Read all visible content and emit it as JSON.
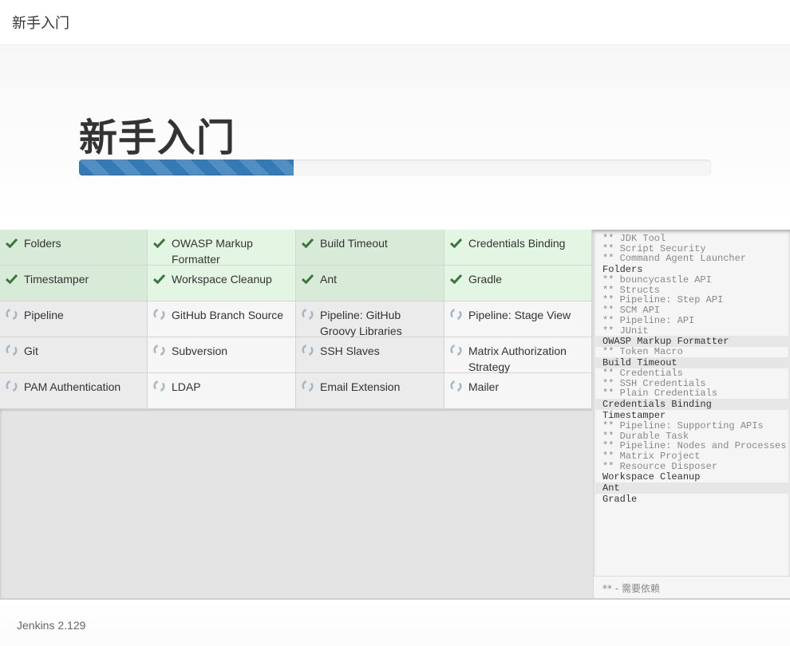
{
  "header": {
    "title": "新手入门"
  },
  "hero": {
    "title": "新手入门",
    "progress_percent": 34
  },
  "colors": {
    "progress_bar": "#337ab7",
    "success_check": "#3c763d",
    "pending_icon": "#a5b6c4"
  },
  "plugins": [
    {
      "name": "Folders",
      "status": "success"
    },
    {
      "name": "OWASP Markup Formatter",
      "status": "success"
    },
    {
      "name": "Build Timeout",
      "status": "success"
    },
    {
      "name": "Credentials Binding",
      "status": "success"
    },
    {
      "name": "Timestamper",
      "status": "success"
    },
    {
      "name": "Workspace Cleanup",
      "status": "success"
    },
    {
      "name": "Ant",
      "status": "success"
    },
    {
      "name": "Gradle",
      "status": "success"
    },
    {
      "name": "Pipeline",
      "status": "pending"
    },
    {
      "name": "GitHub Branch Source",
      "status": "pending"
    },
    {
      "name": "Pipeline: GitHub Groovy Libraries",
      "status": "pending"
    },
    {
      "name": "Pipeline: Stage View",
      "status": "pending"
    },
    {
      "name": "Git",
      "status": "pending"
    },
    {
      "name": "Subversion",
      "status": "pending"
    },
    {
      "name": "SSH Slaves",
      "status": "pending"
    },
    {
      "name": "Matrix Authorization Strategy",
      "status": "pending"
    },
    {
      "name": "PAM Authentication",
      "status": "pending"
    },
    {
      "name": "LDAP",
      "status": "pending"
    },
    {
      "name": "Email Extension",
      "status": "pending"
    },
    {
      "name": "Mailer",
      "status": "pending"
    }
  ],
  "log": [
    {
      "text": "** JDK Tool",
      "dep": true
    },
    {
      "text": "** Script Security",
      "dep": true
    },
    {
      "text": "** Command Agent Launcher",
      "dep": true
    },
    {
      "text": "Folders",
      "dep": false,
      "hl": false
    },
    {
      "text": "** bouncycastle API",
      "dep": true
    },
    {
      "text": "** Structs",
      "dep": true
    },
    {
      "text": "** Pipeline: Step API",
      "dep": true
    },
    {
      "text": "** SCM API",
      "dep": true
    },
    {
      "text": "** Pipeline: API",
      "dep": true
    },
    {
      "text": "** JUnit",
      "dep": true
    },
    {
      "text": "OWASP Markup Formatter",
      "dep": false,
      "hl": true
    },
    {
      "text": "** Token Macro",
      "dep": true
    },
    {
      "text": "Build Timeout",
      "dep": false,
      "hl": true
    },
    {
      "text": "** Credentials",
      "dep": true
    },
    {
      "text": "** SSH Credentials",
      "dep": true
    },
    {
      "text": "** Plain Credentials",
      "dep": true
    },
    {
      "text": "Credentials Binding",
      "dep": false,
      "hl": true
    },
    {
      "text": "Timestamper",
      "dep": false,
      "hl": false
    },
    {
      "text": "** Pipeline: Supporting APIs",
      "dep": true
    },
    {
      "text": "** Durable Task",
      "dep": true
    },
    {
      "text": "** Pipeline: Nodes and Processes",
      "dep": true
    },
    {
      "text": "** Matrix Project",
      "dep": true
    },
    {
      "text": "** Resource Disposer",
      "dep": true
    },
    {
      "text": "Workspace Cleanup",
      "dep": false,
      "hl": false
    },
    {
      "text": "Ant",
      "dep": false,
      "hl": true
    },
    {
      "text": "Gradle",
      "dep": false,
      "hl": false
    }
  ],
  "log_footer": "** - 需要依赖",
  "footer": {
    "version": "Jenkins 2.129"
  }
}
